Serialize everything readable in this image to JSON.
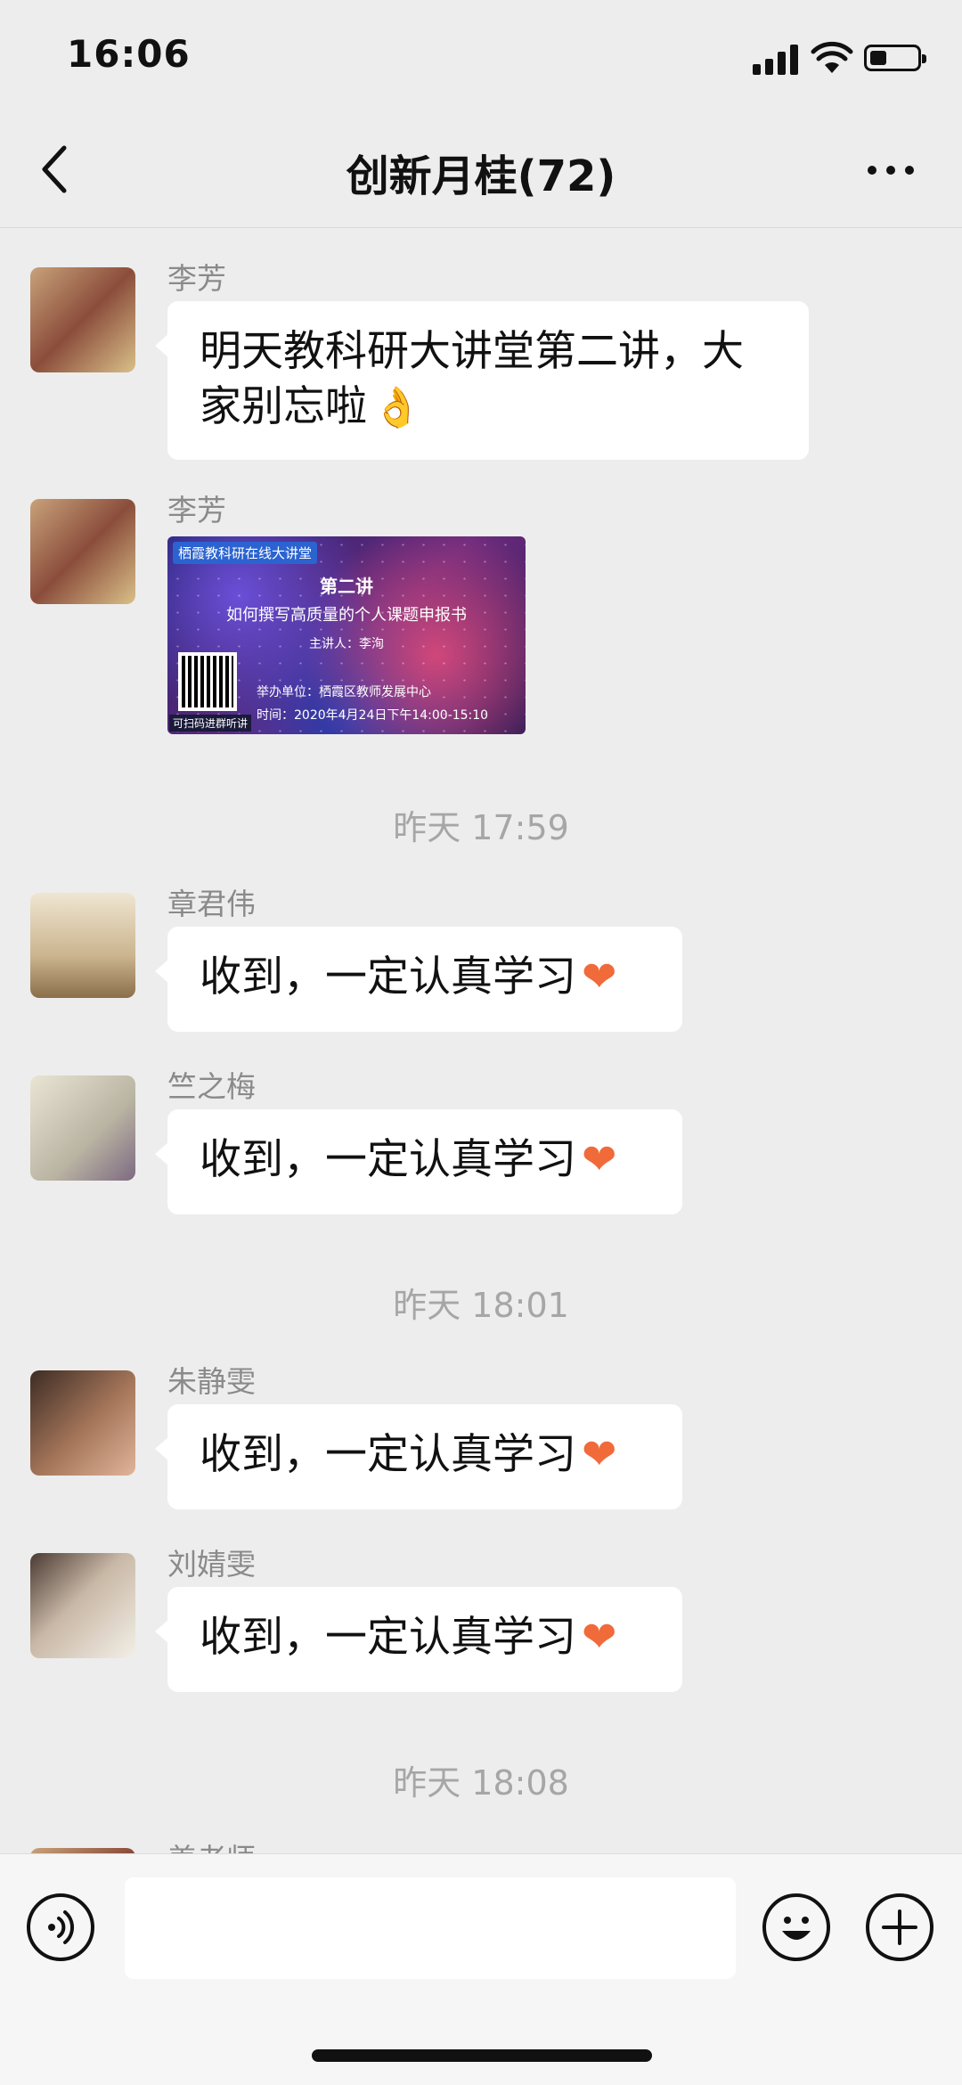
{
  "status_bar": {
    "time": "16:06"
  },
  "nav": {
    "title": "创新月桂(72)"
  },
  "messages": [
    {
      "sender": "李芳",
      "text": "明天教科研大讲堂第二讲，大家别忘啦"
    },
    {
      "sender": "李芳",
      "image": {
        "header": "栖霞教科研在线大讲堂",
        "title": "第二讲",
        "subtitle": "如何撰写高质量的个人课题申报书",
        "speaker": "主讲人：李洵",
        "organizer": "举办单位：栖霞区教师发展中心",
        "time": "时间：2020年4月24日下午14:00-15:10",
        "qr_caption": "可扫码进群听讲"
      }
    },
    {
      "sender": "章君伟",
      "text": "收到，一定认真学习"
    },
    {
      "sender": "竺之梅",
      "text": "收到，一定认真学习"
    },
    {
      "sender": "朱静雯",
      "text": "收到，一定认真学习"
    },
    {
      "sender": "刘婧雯",
      "text": "收到，一定认真学习"
    },
    {
      "sender": "姜老师"
    }
  ],
  "time_separators": [
    "昨天 17:59",
    "昨天 18:01",
    "昨天 18:08"
  ],
  "colors": {
    "background": "#ededed",
    "bubble": "#ffffff",
    "heart": "#f06a3a"
  },
  "icons": [
    "back-icon",
    "more-icon",
    "voice-icon",
    "emoji-icon",
    "plus-icon"
  ]
}
